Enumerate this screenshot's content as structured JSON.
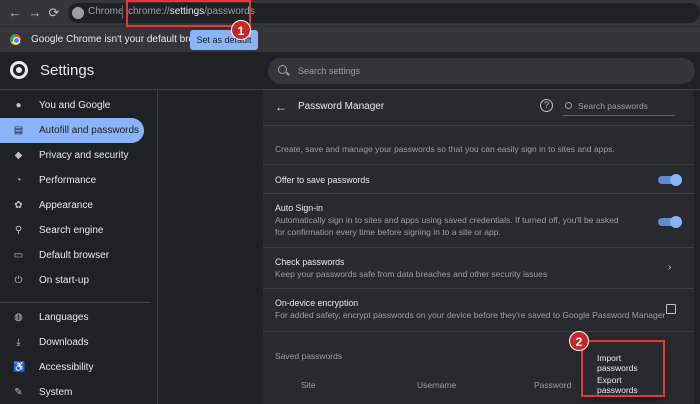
{
  "browser": {
    "back_icon": "←",
    "forward_icon": "→",
    "reload_icon": "⟳",
    "site_label": "Chrome",
    "url_prefix": "chrome://",
    "url_host": "settings",
    "url_path": "/passwords"
  },
  "infobar": {
    "message": "Google Chrome isn't your default browser",
    "button": "Set as default"
  },
  "annotations": {
    "step1": "1",
    "step2": "2"
  },
  "header": {
    "title": "Settings",
    "search_placeholder": "Search settings"
  },
  "sidebar": {
    "items": [
      {
        "label": "You and Google",
        "icon": "person-icon"
      },
      {
        "label": "Autofill and passwords",
        "icon": "clipboard-icon",
        "active": true
      },
      {
        "label": "Privacy and security",
        "icon": "shield-icon"
      },
      {
        "label": "Performance",
        "icon": "speedometer-icon"
      },
      {
        "label": "Appearance",
        "icon": "palette-icon"
      },
      {
        "label": "Search engine",
        "icon": "search-icon"
      },
      {
        "label": "Default browser",
        "icon": "browser-icon"
      },
      {
        "label": "On start-up",
        "icon": "power-icon"
      },
      {
        "label": "Languages",
        "icon": "globe-icon"
      },
      {
        "label": "Downloads",
        "icon": "download-icon"
      },
      {
        "label": "Accessibility",
        "icon": "accessibility-icon"
      },
      {
        "label": "System",
        "icon": "wrench-icon"
      }
    ]
  },
  "password_manager": {
    "title": "Password Manager",
    "search_placeholder": "Search passwords",
    "description": "Create, save and manage your passwords so that you can easily sign in to sites and apps.",
    "offer_to_save": "Offer to save passwords",
    "auto_signin_title": "Auto Sign-in",
    "auto_signin_desc": "Automatically sign in to sites and apps using saved credentials. If turned off, you'll be asked for confirmation every time before signing in to a site or app.",
    "check_title": "Check passwords",
    "check_desc": "Keep your passwords safe from data breaches and other security issues",
    "encryption_title": "On-device encryption",
    "encryption_desc": "For added safety, encrypt passwords on your device before they're saved to Google Password Manager",
    "saved_label": "Saved passwords",
    "columns": [
      "Site",
      "Username",
      "Password"
    ]
  },
  "menu": {
    "import": "Import passwords",
    "export": "Export passwords"
  }
}
